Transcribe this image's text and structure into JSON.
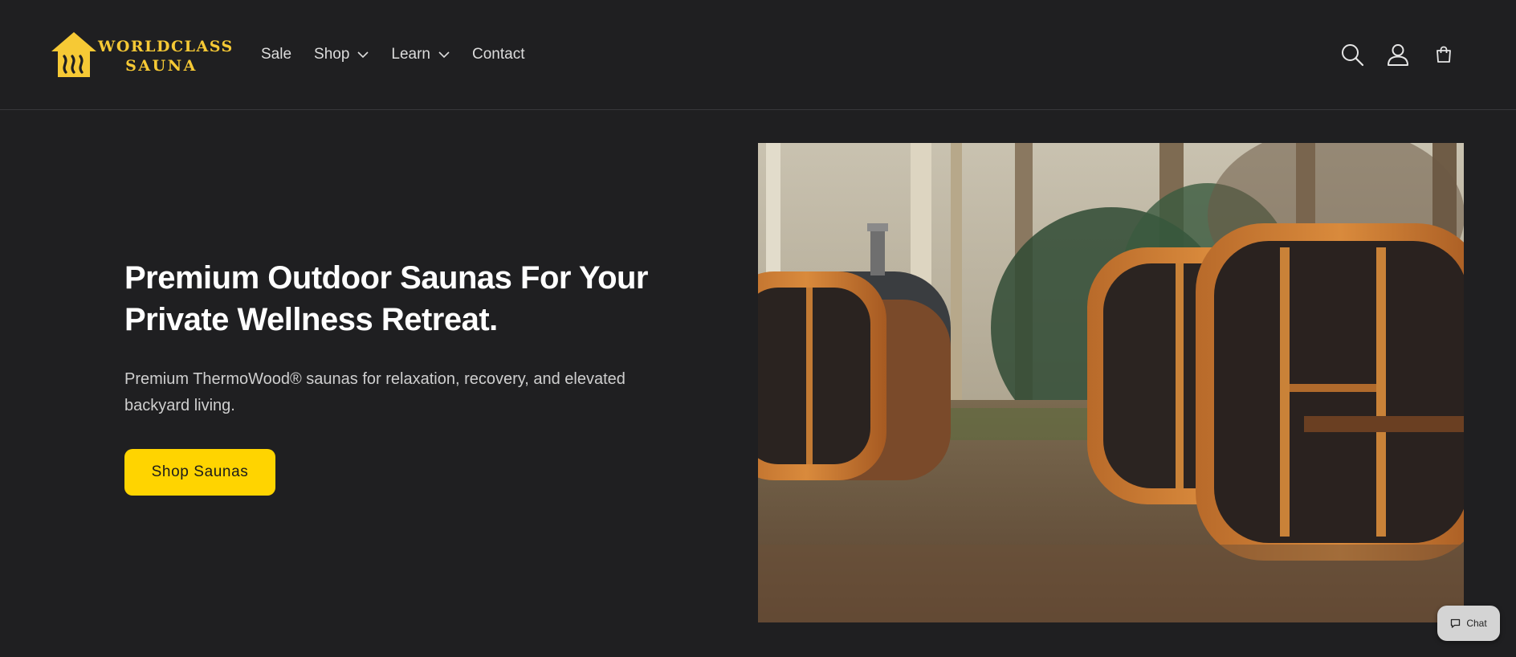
{
  "brand": {
    "line1": "WORLDCLASS",
    "line2": "SAUNA",
    "color": "#f6c935",
    "logo_icon": "house-steam-icon"
  },
  "nav": {
    "items": [
      {
        "label": "Sale",
        "has_dropdown": false
      },
      {
        "label": "Shop",
        "has_dropdown": true
      },
      {
        "label": "Learn",
        "has_dropdown": true
      },
      {
        "label": "Contact",
        "has_dropdown": false
      }
    ]
  },
  "header_icons": [
    "search-icon",
    "account-icon",
    "cart-icon"
  ],
  "hero": {
    "title": "Premium Outdoor Saunas For Your Private Wellness Retreat.",
    "subtitle": "Premium ThermoWood® saunas for relaxation, recovery, and elevated backyard living.",
    "cta_label": "Shop Saunas",
    "cta_color": "#ffd400",
    "image": "outdoor-cube-saunas-photo"
  },
  "chat": {
    "label": "Chat"
  },
  "colors": {
    "background": "#1f1f21",
    "text": "#ffffff",
    "muted_text": "#cfcfcf"
  }
}
